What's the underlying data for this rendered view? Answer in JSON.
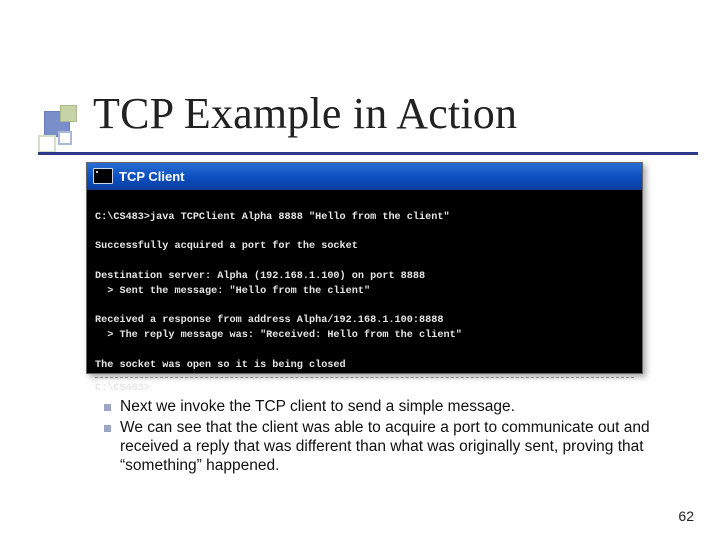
{
  "title": "TCP Example in Action",
  "console": {
    "window_title": "TCP Client",
    "lines": {
      "l0": "C:\\CS483>java TCPClient Alpha 8888 \"Hello from the client\"",
      "l1": "Successfully acquired a port for the socket",
      "l2": "Destination server: Alpha (192.168.1.100) on port 8888",
      "l3": "  > Sent the message: \"Hello from the client\"",
      "l4": "Received a response from address Alpha/192.168.1.100:8888",
      "l5": "  > The reply message was: \"Received: Hello from the client\"",
      "l6": "The socket was open so it is being closed",
      "l7": "C:\\CS483>"
    }
  },
  "bullets": {
    "b0": "Next we invoke the TCP client to send a simple message.",
    "b1": "We can see that the client was able to acquire a port to communicate out and received a reply that was different than what was originally sent, proving that “something” happened."
  },
  "page_number": "62"
}
